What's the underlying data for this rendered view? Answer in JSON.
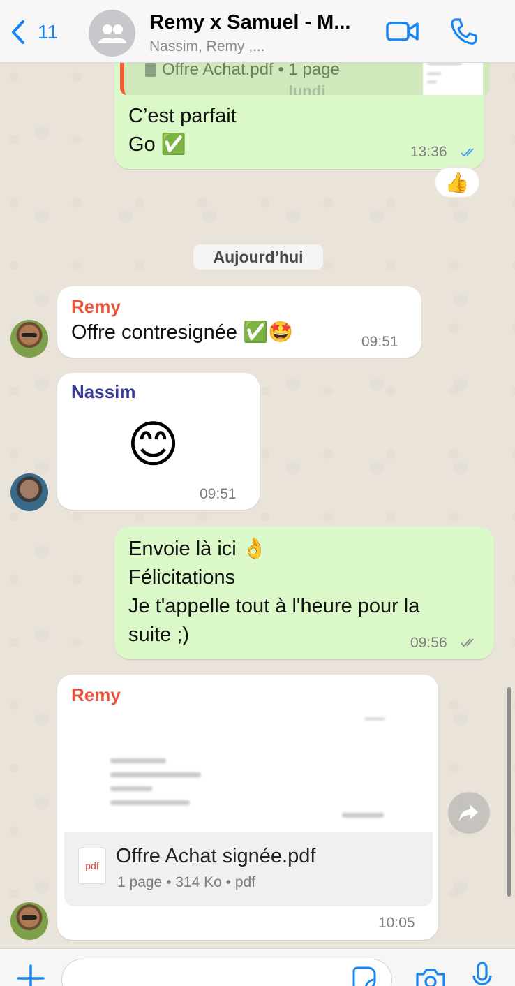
{
  "header": {
    "back_count": "11",
    "title": "Remy x Samuel - M...",
    "members": "Nassim, Remy ,..."
  },
  "messages": {
    "m1": {
      "quote_doc": "Offre Achat.pdf • 1 page",
      "quote_faded_day": "lundi",
      "line1": "C’est parfait",
      "line2": "Go ✅",
      "time": "13:36",
      "reaction": "👍"
    },
    "date_chip": "Aujourd’hui",
    "m2": {
      "sender": "Remy",
      "sender_color": "#e8553f",
      "text": "Offre contresignée ✅🤩",
      "time": "09:51"
    },
    "m3": {
      "sender": "Nassim",
      "sender_color": "#3a3a9a",
      "emoji": "😊",
      "time": "09:51"
    },
    "m4": {
      "line1": "Envoie là ici 👌",
      "line2": "Félicitations",
      "line3": "Je t'appelle tout à l'heure pour la",
      "line4": "suite ;)",
      "time": "09:56"
    },
    "m5": {
      "sender": "Remy",
      "sender_color": "#e8553f",
      "pdf_label": "pdf",
      "doc_name": "Offre Achat signée.pdf",
      "doc_meta": "1 page • 314 Ko • pdf",
      "time": "10:05"
    }
  },
  "icons": {
    "back": "chevron-left-icon",
    "group": "group-avatar-icon",
    "video": "video-camera-icon",
    "call": "phone-icon",
    "forward": "forward-icon",
    "plus": "plus-icon",
    "sticker": "sticker-icon",
    "camera": "camera-icon",
    "mic": "microphone-icon"
  },
  "colors": {
    "accent": "#1a86f0",
    "outgoing_bubble": "#dbf8c8",
    "incoming_bubble": "#ffffff",
    "read_ticks": "#4fa3e8"
  }
}
